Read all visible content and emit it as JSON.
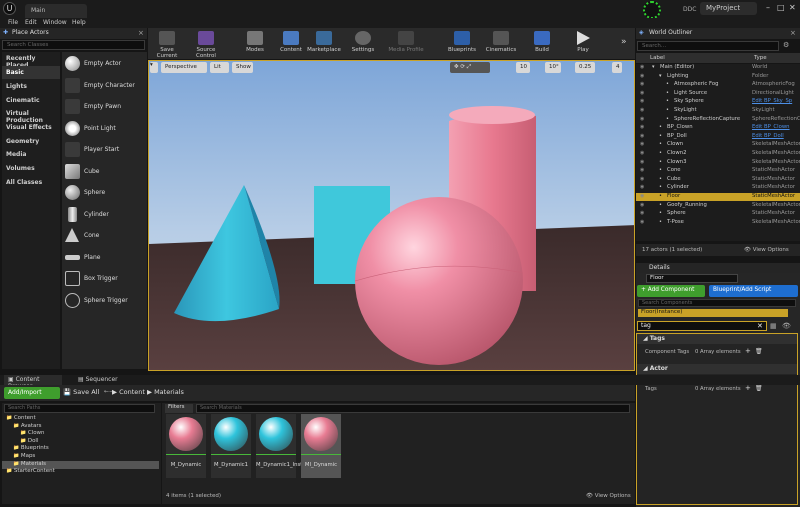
{
  "app": {
    "tab": "Main",
    "menu": [
      "File",
      "Edit",
      "Window",
      "Help"
    ],
    "ddc_label": "DDC",
    "project": "MyProject"
  },
  "place_actors": {
    "title": "Place Actors",
    "search_placeholder": "Search Classes",
    "categories": [
      "Recently Placed",
      "Basic",
      "Lights",
      "Cinematic",
      "Virtual Production",
      "Visual Effects",
      "Geometry",
      "Media",
      "Volumes",
      "All Classes"
    ],
    "active_category": "Basic",
    "actors": [
      "Empty Actor",
      "Empty Character",
      "Empty Pawn",
      "Point Light",
      "Player Start",
      "Cube",
      "Sphere",
      "Cylinder",
      "Cone",
      "Plane",
      "Box Trigger",
      "Sphere Trigger"
    ]
  },
  "toolbar": {
    "buttons": [
      "Save Current",
      "Source Control",
      "Modes",
      "Content",
      "Marketplace",
      "Settings",
      "Media Profile",
      "Blueprints",
      "Cinematics",
      "Build",
      "Play"
    ]
  },
  "viewport": {
    "perspective": "Perspective",
    "lit": "Lit",
    "show": "Show",
    "grid_snap": "10",
    "rot_snap": "10°",
    "scale_snap": "0.25",
    "cam_speed": "4"
  },
  "outliner": {
    "title": "World Outliner",
    "search_placeholder": "Search...",
    "col_label": "Label",
    "col_type": "Type",
    "rows": [
      {
        "label": "Main (Editor)",
        "type": "World",
        "indent": 0,
        "link": false,
        "sel": false
      },
      {
        "label": "Lighting",
        "type": "Folder",
        "indent": 1,
        "link": false,
        "sel": false
      },
      {
        "label": "Atmospheric Fog",
        "type": "AtmosphericFog",
        "indent": 2,
        "link": false,
        "sel": false
      },
      {
        "label": "Light Source",
        "type": "DirectionalLight",
        "indent": 2,
        "link": false,
        "sel": false
      },
      {
        "label": "Sky Sphere",
        "type": "Edit BP_Sky_Sp",
        "indent": 2,
        "link": true,
        "sel": false
      },
      {
        "label": "SkyLight",
        "type": "SkyLight",
        "indent": 2,
        "link": false,
        "sel": false
      },
      {
        "label": "SphereReflectionCapture",
        "type": "SphereReflectionCapture",
        "indent": 2,
        "link": false,
        "sel": false
      },
      {
        "label": "BP_Clown",
        "type": "Edit BP_Clown",
        "indent": 1,
        "link": true,
        "sel": false
      },
      {
        "label": "BP_Doll",
        "type": "Edit BP_Doll",
        "indent": 1,
        "link": true,
        "sel": false
      },
      {
        "label": "Clown",
        "type": "SkeletalMeshActor",
        "indent": 1,
        "link": false,
        "sel": false
      },
      {
        "label": "Clown2",
        "type": "SkeletalMeshActor",
        "indent": 1,
        "link": false,
        "sel": false
      },
      {
        "label": "Clown3",
        "type": "SkeletalMeshActor",
        "indent": 1,
        "link": false,
        "sel": false
      },
      {
        "label": "Cone",
        "type": "StaticMeshActor",
        "indent": 1,
        "link": false,
        "sel": false
      },
      {
        "label": "Cube",
        "type": "StaticMeshActor",
        "indent": 1,
        "link": false,
        "sel": false
      },
      {
        "label": "Cylinder",
        "type": "StaticMeshActor",
        "indent": 1,
        "link": false,
        "sel": false
      },
      {
        "label": "Floor",
        "type": "StaticMeshActor",
        "indent": 1,
        "link": false,
        "sel": true
      },
      {
        "label": "Goofy_Running",
        "type": "SkeletalMeshActor",
        "indent": 1,
        "link": false,
        "sel": false
      },
      {
        "label": "Sphere",
        "type": "StaticMeshActor",
        "indent": 1,
        "link": false,
        "sel": false
      },
      {
        "label": "T-Pose",
        "type": "SkeletalMeshActor",
        "indent": 1,
        "link": false,
        "sel": false
      }
    ],
    "footer_count": "17 actors (1 selected)",
    "view_options": "View Options"
  },
  "details": {
    "title": "Details",
    "name": "Floor",
    "add_component": "+ Add Component",
    "blueprint_script": "Blueprint/Add Script",
    "components_search": "Search Components",
    "component_row": "Floor(Instance)",
    "search_value": "tag",
    "sections": [
      {
        "name": "Tags",
        "prop_label": "Component Tags",
        "prop_value": "0 Array elements"
      },
      {
        "name": "Actor",
        "prop_label": "Tags",
        "prop_value": "0 Array elements"
      }
    ]
  },
  "content_browser": {
    "tabs": [
      "Content Browser",
      "Sequencer"
    ],
    "add_import": "Add/Import",
    "save_all": "Save All",
    "path": [
      "Content",
      "Materials"
    ],
    "paths_search": "Search Paths",
    "filters": "Filters",
    "materials_search": "Search Materials",
    "tree": [
      {
        "label": "Content",
        "indent": 0,
        "sel": false
      },
      {
        "label": "Avatars",
        "indent": 1,
        "sel": false
      },
      {
        "label": "Clown",
        "indent": 2,
        "sel": false
      },
      {
        "label": "Doll",
        "indent": 2,
        "sel": false
      },
      {
        "label": "Blueprints",
        "indent": 1,
        "sel": false
      },
      {
        "label": "Maps",
        "indent": 1,
        "sel": false
      },
      {
        "label": "Materials",
        "indent": 1,
        "sel": true
      },
      {
        "label": "StarterContent",
        "indent": 0,
        "sel": false
      }
    ],
    "assets": [
      {
        "label": "M_Dynamic",
        "color": "#e87c93",
        "sel": false
      },
      {
        "label": "M_Dynamic1",
        "color": "#2fc4dc",
        "sel": false
      },
      {
        "label": "M_Dynamic1_Inst1",
        "color": "#2fc4dc",
        "sel": false
      },
      {
        "label": "MI_Dynamic",
        "color": "#e87c93",
        "sel": true
      }
    ],
    "count": "4 items (1 selected)",
    "view_options": "View Options"
  },
  "colors": {
    "selection": "#c9a227",
    "add_green": "#3f9e2d",
    "blueprint_blue": "#1e6ed0",
    "pink": "#e87c93",
    "cyan": "#2fc4dc"
  }
}
